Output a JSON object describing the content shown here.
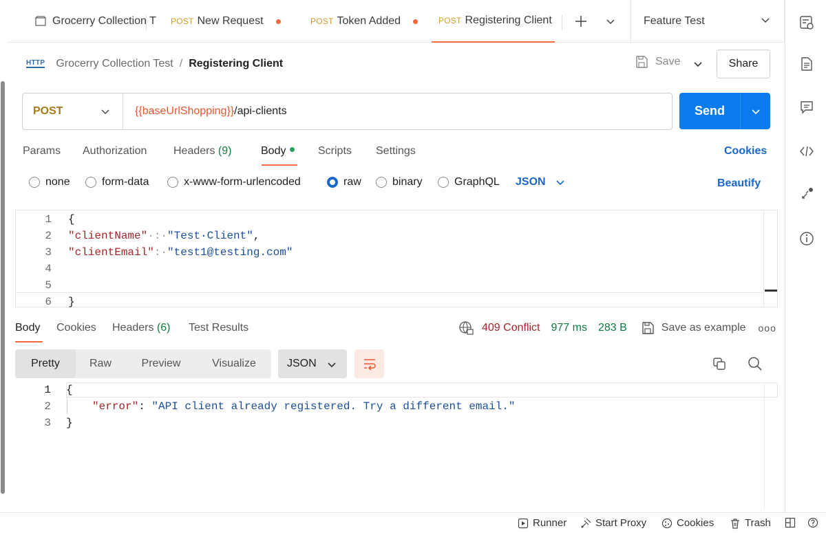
{
  "tabs": [
    {
      "method": "",
      "label": "Grocerry Collection T",
      "unsaved": false,
      "active": false
    },
    {
      "method": "POST",
      "label": "New Request",
      "unsaved": true,
      "active": false
    },
    {
      "method": "POST",
      "label": "Token Added",
      "unsaved": true,
      "active": false
    },
    {
      "method": "POST",
      "label": "Registering Client",
      "unsaved": false,
      "active": true
    }
  ],
  "environment": "Feature Test",
  "breadcrumb": {
    "badge": "HTTP",
    "collection": "Grocerry Collection Test",
    "separator": "/",
    "request": "Registering Client"
  },
  "actions": {
    "save": "Save",
    "share": "Share",
    "send": "Send"
  },
  "request": {
    "method": "POST",
    "url_variable": "{{baseUrlShopping}}",
    "url_path": "/api-clients"
  },
  "request_tabs": [
    {
      "label": "Params",
      "count": ""
    },
    {
      "label": "Authorization",
      "count": ""
    },
    {
      "label": "Headers ",
      "count": "(9)"
    },
    {
      "label": "Body",
      "count": ""
    },
    {
      "label": "Scripts",
      "count": ""
    },
    {
      "label": "Settings",
      "count": ""
    }
  ],
  "cookies_link": "Cookies",
  "body_types": [
    "none",
    "form-data",
    "x-www-form-urlencoded",
    "raw",
    "binary",
    "GraphQL"
  ],
  "body_type_selected": "raw",
  "body_format": "JSON",
  "beautify": "Beautify",
  "request_body": {
    "line_numbers": [
      "1",
      "2",
      "3",
      "4",
      "5",
      "6"
    ],
    "open": "{",
    "close": "}",
    "key1": "\"clientName\"",
    "sep1": "·:·",
    "val1": "\"Test·Client\"",
    "comma": ",",
    "key2": "\"clientEmail\"",
    "sep2": ":·",
    "val2": "\"test1@testing.com\""
  },
  "response_tabs": [
    {
      "label": "Body",
      "count": ""
    },
    {
      "label": "Cookies",
      "count": ""
    },
    {
      "label": "Headers ",
      "count": "(6)"
    },
    {
      "label": "Test Results",
      "count": ""
    }
  ],
  "response_meta": {
    "status": "409 Conflict",
    "time": "977 ms",
    "size": "283 B",
    "save_example": "Save as example",
    "more": "ooo"
  },
  "view_modes": [
    "Pretty",
    "Raw",
    "Preview",
    "Visualize"
  ],
  "response_format": "JSON",
  "response_body": {
    "line_numbers": [
      "1",
      "2",
      "3"
    ],
    "open": "{",
    "close": "}",
    "key": "\"error\"",
    "sep": ": ",
    "value": "\"API client already registered. Try a different email.\""
  },
  "statusbar": [
    "Runner",
    "Start Proxy",
    "Cookies",
    "Trash"
  ],
  "colors": {
    "accent": "#f26b3a",
    "send": "#097bed",
    "link": "#1a66c9",
    "status_error": "#a1262b",
    "ok_green": "#0f7b3f"
  }
}
